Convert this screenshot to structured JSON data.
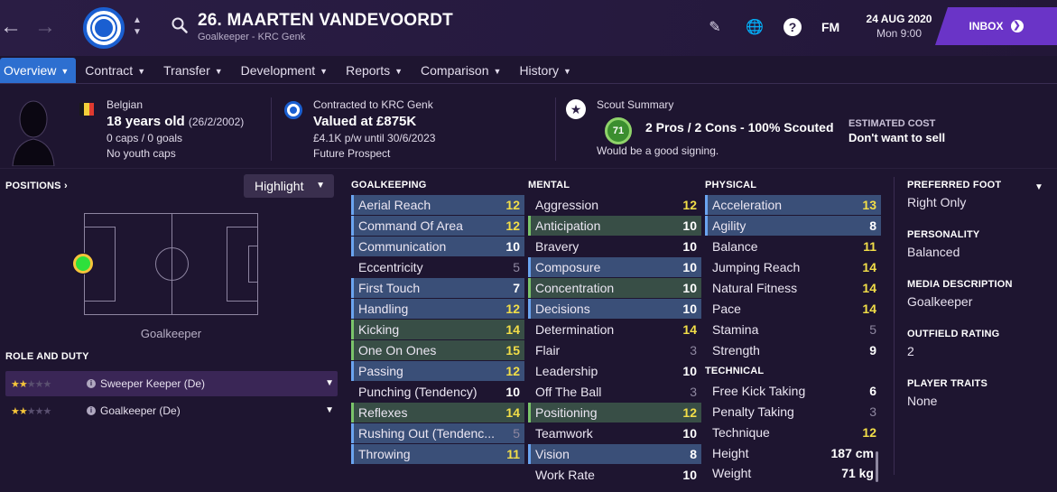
{
  "header": {
    "player_name": "26. MAARTEN VANDEVOORDT",
    "subtitle": "Goalkeeper - KRC Genk",
    "fm_logo": "FM",
    "date": "24 AUG 2020",
    "time": "Mon 9:00",
    "inbox_label": "INBOX",
    "icons": [
      "back-arrow-icon",
      "forward-arrow-icon",
      "search-icon",
      "pencil-icon",
      "globe-icon",
      "help-icon"
    ]
  },
  "tabs": [
    {
      "label": "Overview",
      "active": true
    },
    {
      "label": "Contract"
    },
    {
      "label": "Transfer"
    },
    {
      "label": "Development"
    },
    {
      "label": "Reports"
    },
    {
      "label": "Comparison"
    },
    {
      "label": "History"
    }
  ],
  "info": {
    "nationality": "Belgian",
    "age": "18 years old",
    "dob": "(26/2/2002)",
    "caps": "0 caps / 0 goals",
    "youth_caps": "No youth caps",
    "contract_club": "Contracted to KRC Genk",
    "value": "Valued at £875K",
    "wage": "£4.1K p/w until 30/6/2023",
    "prospect": "Future Prospect",
    "scout_title": "Scout Summary",
    "scout_rating": "71",
    "scout_line": "2 Pros / 2 Cons - 100% Scouted",
    "scout_note": "Would be a good signing.",
    "cost_title": "ESTIMATED COST",
    "cost_value": "Don't want to sell"
  },
  "positions": {
    "title": "POSITIONS",
    "highlight_label": "Highlight",
    "position_label": "Goalkeeper"
  },
  "roles": {
    "title": "ROLE AND DUTY",
    "items": [
      {
        "label": "Sweeper Keeper (De)",
        "stars": 2,
        "selected": true
      },
      {
        "label": "Goalkeeper (De)",
        "stars": 2,
        "selected": false
      }
    ]
  },
  "attributes": {
    "goalkeeping": {
      "title": "GOALKEEPING",
      "items": [
        {
          "label": "Aerial Reach",
          "value": "12"
        },
        {
          "label": "Command Of Area",
          "value": "12"
        },
        {
          "label": "Communication",
          "value": "10"
        },
        {
          "label": "Eccentricity",
          "value": "5"
        },
        {
          "label": "First Touch",
          "value": "7"
        },
        {
          "label": "Handling",
          "value": "12"
        },
        {
          "label": "Kicking",
          "value": "14"
        },
        {
          "label": "One On Ones",
          "value": "15"
        },
        {
          "label": "Passing",
          "value": "12"
        },
        {
          "label": "Punching (Tendency)",
          "value": "10"
        },
        {
          "label": "Reflexes",
          "value": "14"
        },
        {
          "label": "Rushing Out (Tendenc...",
          "value": "5"
        },
        {
          "label": "Throwing",
          "value": "11"
        }
      ]
    },
    "mental": {
      "title": "MENTAL",
      "items": [
        {
          "label": "Aggression",
          "value": "12"
        },
        {
          "label": "Anticipation",
          "value": "10"
        },
        {
          "label": "Bravery",
          "value": "10"
        },
        {
          "label": "Composure",
          "value": "10"
        },
        {
          "label": "Concentration",
          "value": "10"
        },
        {
          "label": "Decisions",
          "value": "10"
        },
        {
          "label": "Determination",
          "value": "14"
        },
        {
          "label": "Flair",
          "value": "3"
        },
        {
          "label": "Leadership",
          "value": "10"
        },
        {
          "label": "Off The Ball",
          "value": "3"
        },
        {
          "label": "Positioning",
          "value": "12"
        },
        {
          "label": "Teamwork",
          "value": "10"
        },
        {
          "label": "Vision",
          "value": "8"
        },
        {
          "label": "Work Rate",
          "value": "10"
        }
      ]
    },
    "physical": {
      "title": "PHYSICAL",
      "items": [
        {
          "label": "Acceleration",
          "value": "13"
        },
        {
          "label": "Agility",
          "value": "8"
        },
        {
          "label": "Balance",
          "value": "11"
        },
        {
          "label": "Jumping Reach",
          "value": "14"
        },
        {
          "label": "Natural Fitness",
          "value": "14"
        },
        {
          "label": "Pace",
          "value": "14"
        },
        {
          "label": "Stamina",
          "value": "5"
        },
        {
          "label": "Strength",
          "value": "9"
        }
      ]
    },
    "technical": {
      "title": "TECHNICAL",
      "items": [
        {
          "label": "Free Kick Taking",
          "value": "6"
        },
        {
          "label": "Penalty Taking",
          "value": "3"
        },
        {
          "label": "Technique",
          "value": "12"
        }
      ]
    },
    "body": {
      "height_label": "Height",
      "height": "187 cm",
      "weight_label": "Weight",
      "weight": "71 kg"
    }
  },
  "side": {
    "preferred_foot_title": "PREFERRED FOOT",
    "preferred_foot": "Right Only",
    "personality_title": "PERSONALITY",
    "personality": "Balanced",
    "media_title": "MEDIA DESCRIPTION",
    "media": "Goalkeeper",
    "outfield_title": "OUTFIELD RATING",
    "outfield": "2",
    "traits_title": "PLAYER TRAITS",
    "traits": "None"
  },
  "colors": {
    "background": "#1e1530",
    "accent_blue": "#2d6fd0",
    "inbox_purple": "#6a34c7",
    "key_highlight_blue": "#3a4f78",
    "key_highlight_green": "#384e46",
    "high_value": "#f2de48"
  }
}
